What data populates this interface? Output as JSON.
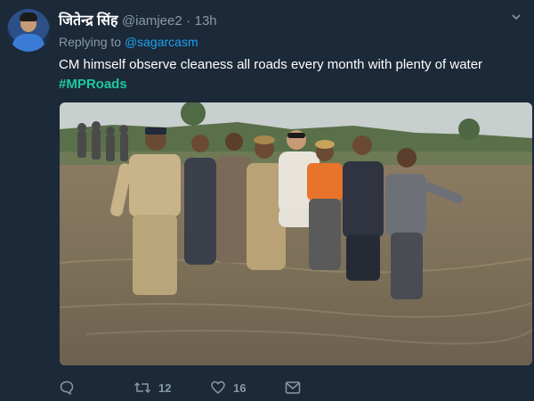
{
  "tweet": {
    "display_name": "जितेन्द्र सिंह",
    "handle": "@iamjee2",
    "separator": "·",
    "time": "13h",
    "replying_prefix": "Replying to",
    "replying_to": "@sagarcasm",
    "text": "CM himself observe cleaness all roads every month with plenty of water",
    "hashtag": "#MPRoads",
    "media_icon": "photo-of-people-wading-through-flooded-road",
    "actions": {
      "reply_icon": "speech-bubble-icon",
      "retweet_icon": "retweet-icon",
      "retweet_count": "12",
      "like_icon": "heart-icon",
      "like_count": "16",
      "dm_icon": "envelope-icon"
    },
    "colors": {
      "background": "#1c2938",
      "link": "#1da1f2",
      "hashtag": "#1dc9a4",
      "muted": "#8899a6"
    }
  }
}
